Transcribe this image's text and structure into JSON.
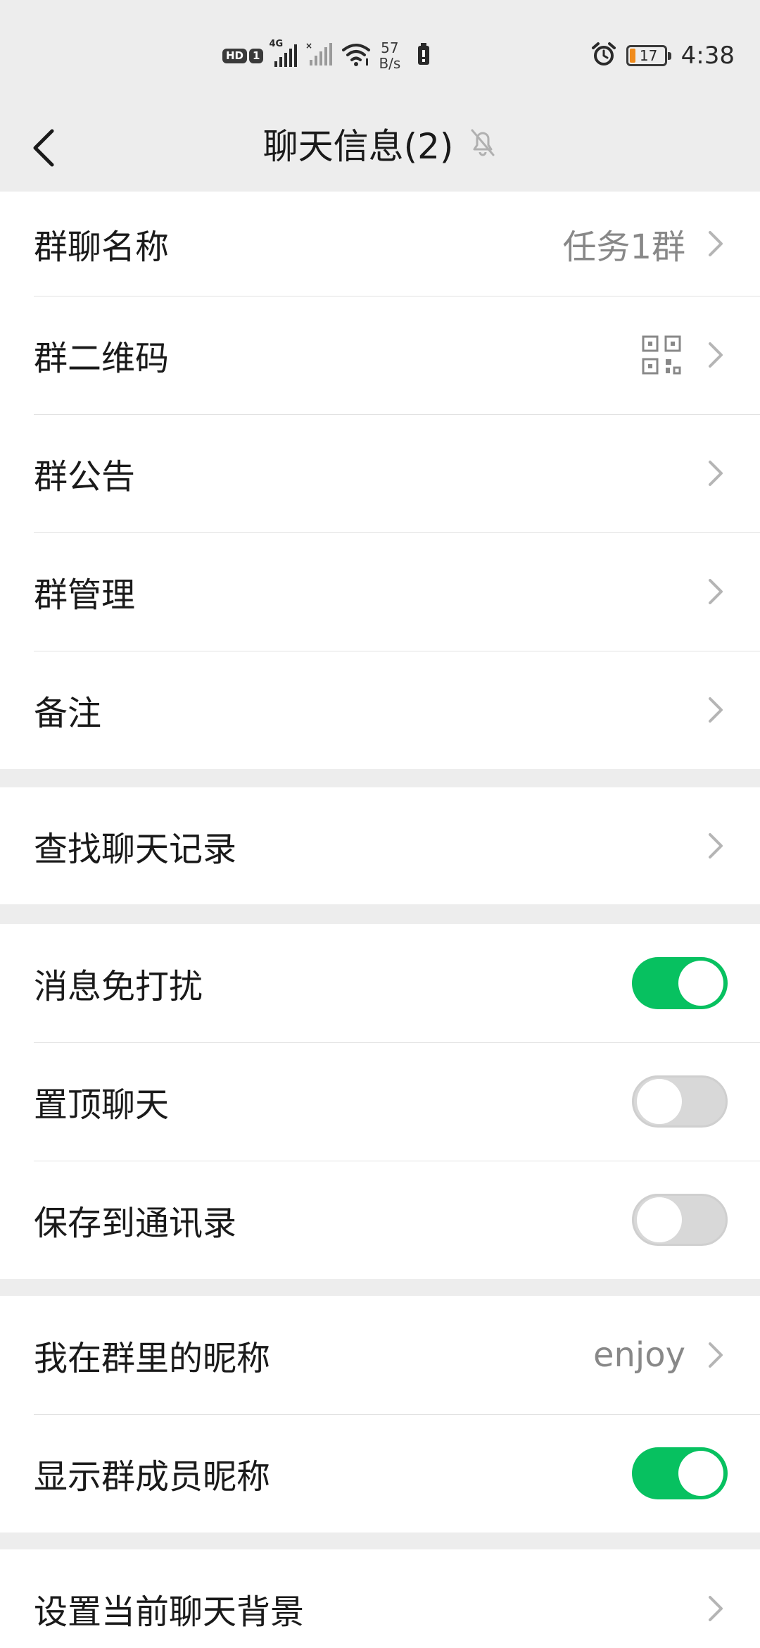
{
  "status_bar": {
    "hd_label": "HD",
    "sim_label": "1",
    "network_label": "4G",
    "speed_value": "57",
    "speed_unit": "B/s",
    "battery_level": "17",
    "battery_fraction": 0.17,
    "time": "4:38"
  },
  "header": {
    "title": "聊天信息(2)"
  },
  "section_group_info": {
    "rows": [
      {
        "label": "群聊名称",
        "value": "任务1群"
      },
      {
        "label": "群二维码"
      },
      {
        "label": "群公告"
      },
      {
        "label": "群管理"
      },
      {
        "label": "备注"
      }
    ]
  },
  "section_search": {
    "rows": [
      {
        "label": "查找聊天记录"
      }
    ]
  },
  "section_toggles": {
    "rows": [
      {
        "label": "消息免打扰",
        "state": "on"
      },
      {
        "label": "置顶聊天",
        "state": "off"
      },
      {
        "label": "保存到通讯录",
        "state": "off"
      }
    ]
  },
  "section_nickname": {
    "rows": [
      {
        "label": "我在群里的昵称",
        "value": "enjoy"
      },
      {
        "label": "显示群成员昵称",
        "state": "on"
      }
    ]
  },
  "section_background": {
    "rows": [
      {
        "label": "设置当前聊天背景"
      }
    ]
  },
  "colors": {
    "accent_green": "#07c160",
    "background": "#ededed",
    "battery_low": "#f08b1c"
  },
  "icons": [
    "back-arrow-icon",
    "muted-bell-icon",
    "qr-code-icon",
    "chevron-right-icon",
    "alarm-icon",
    "wifi-icon",
    "signal-icon",
    "battery-icon"
  ]
}
